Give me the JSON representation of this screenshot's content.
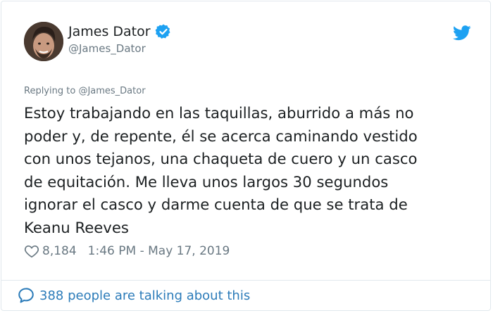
{
  "author": {
    "name": "James Dator",
    "handle": "@James_Dator"
  },
  "reply": {
    "prefix": "Replying to",
    "handle": "@James_Dator"
  },
  "tweet": {
    "text": "Estoy trabajando en las taquillas, aburrido a más no\npoder y, de repente, él se acerca caminando vestido\ncon unos tejanos, una chaqueta de cuero y un casco\nde equitación. Me lleva unos largos 30 segundos\nignorar el casco y darme cuenta de que se trata de\nKeanu Reeves",
    "likes": "8,184",
    "timestamp": "1:46 PM - May 17, 2019"
  },
  "footer": {
    "talking": "388 people are talking about this"
  },
  "icons": {
    "verified": "verified-badge-icon",
    "twitter": "twitter-bird-icon",
    "like": "heart-icon",
    "conversation": "speech-bubble-icon"
  },
  "colors": {
    "twitter_blue": "#1da1f2",
    "link_blue": "#2b7bb9",
    "muted": "#697882",
    "text": "#1c2022"
  }
}
